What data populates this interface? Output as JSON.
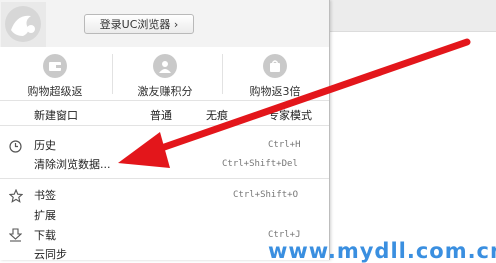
{
  "login_button": "登录UC浏览器 ›",
  "quick_actions": [
    {
      "label": "购物超级返",
      "icon": "wallet-icon"
    },
    {
      "label": "激友赚积分",
      "icon": "user-icon"
    },
    {
      "label": "购物返3倍",
      "icon": "bag-icon"
    }
  ],
  "window_row": [
    "新建窗口",
    "普通",
    "无痕",
    "专家模式"
  ],
  "history": {
    "label": "历史",
    "shortcut": "Ctrl+H"
  },
  "clear_data": {
    "label": "清除浏览数据...",
    "shortcut": "Ctrl+Shift+Del"
  },
  "bookmarks": {
    "label": "书签",
    "shortcut": "Ctrl+Shift+O"
  },
  "extensions": {
    "label": "扩展"
  },
  "downloads": {
    "label": "下载",
    "shortcut": "Ctrl+J"
  },
  "cloud_sync": {
    "label": "云同步"
  },
  "watermark": "www.mydll.com.cn",
  "colors": {
    "arrow": "#e3161b",
    "watermark": "#3a8fe0"
  }
}
